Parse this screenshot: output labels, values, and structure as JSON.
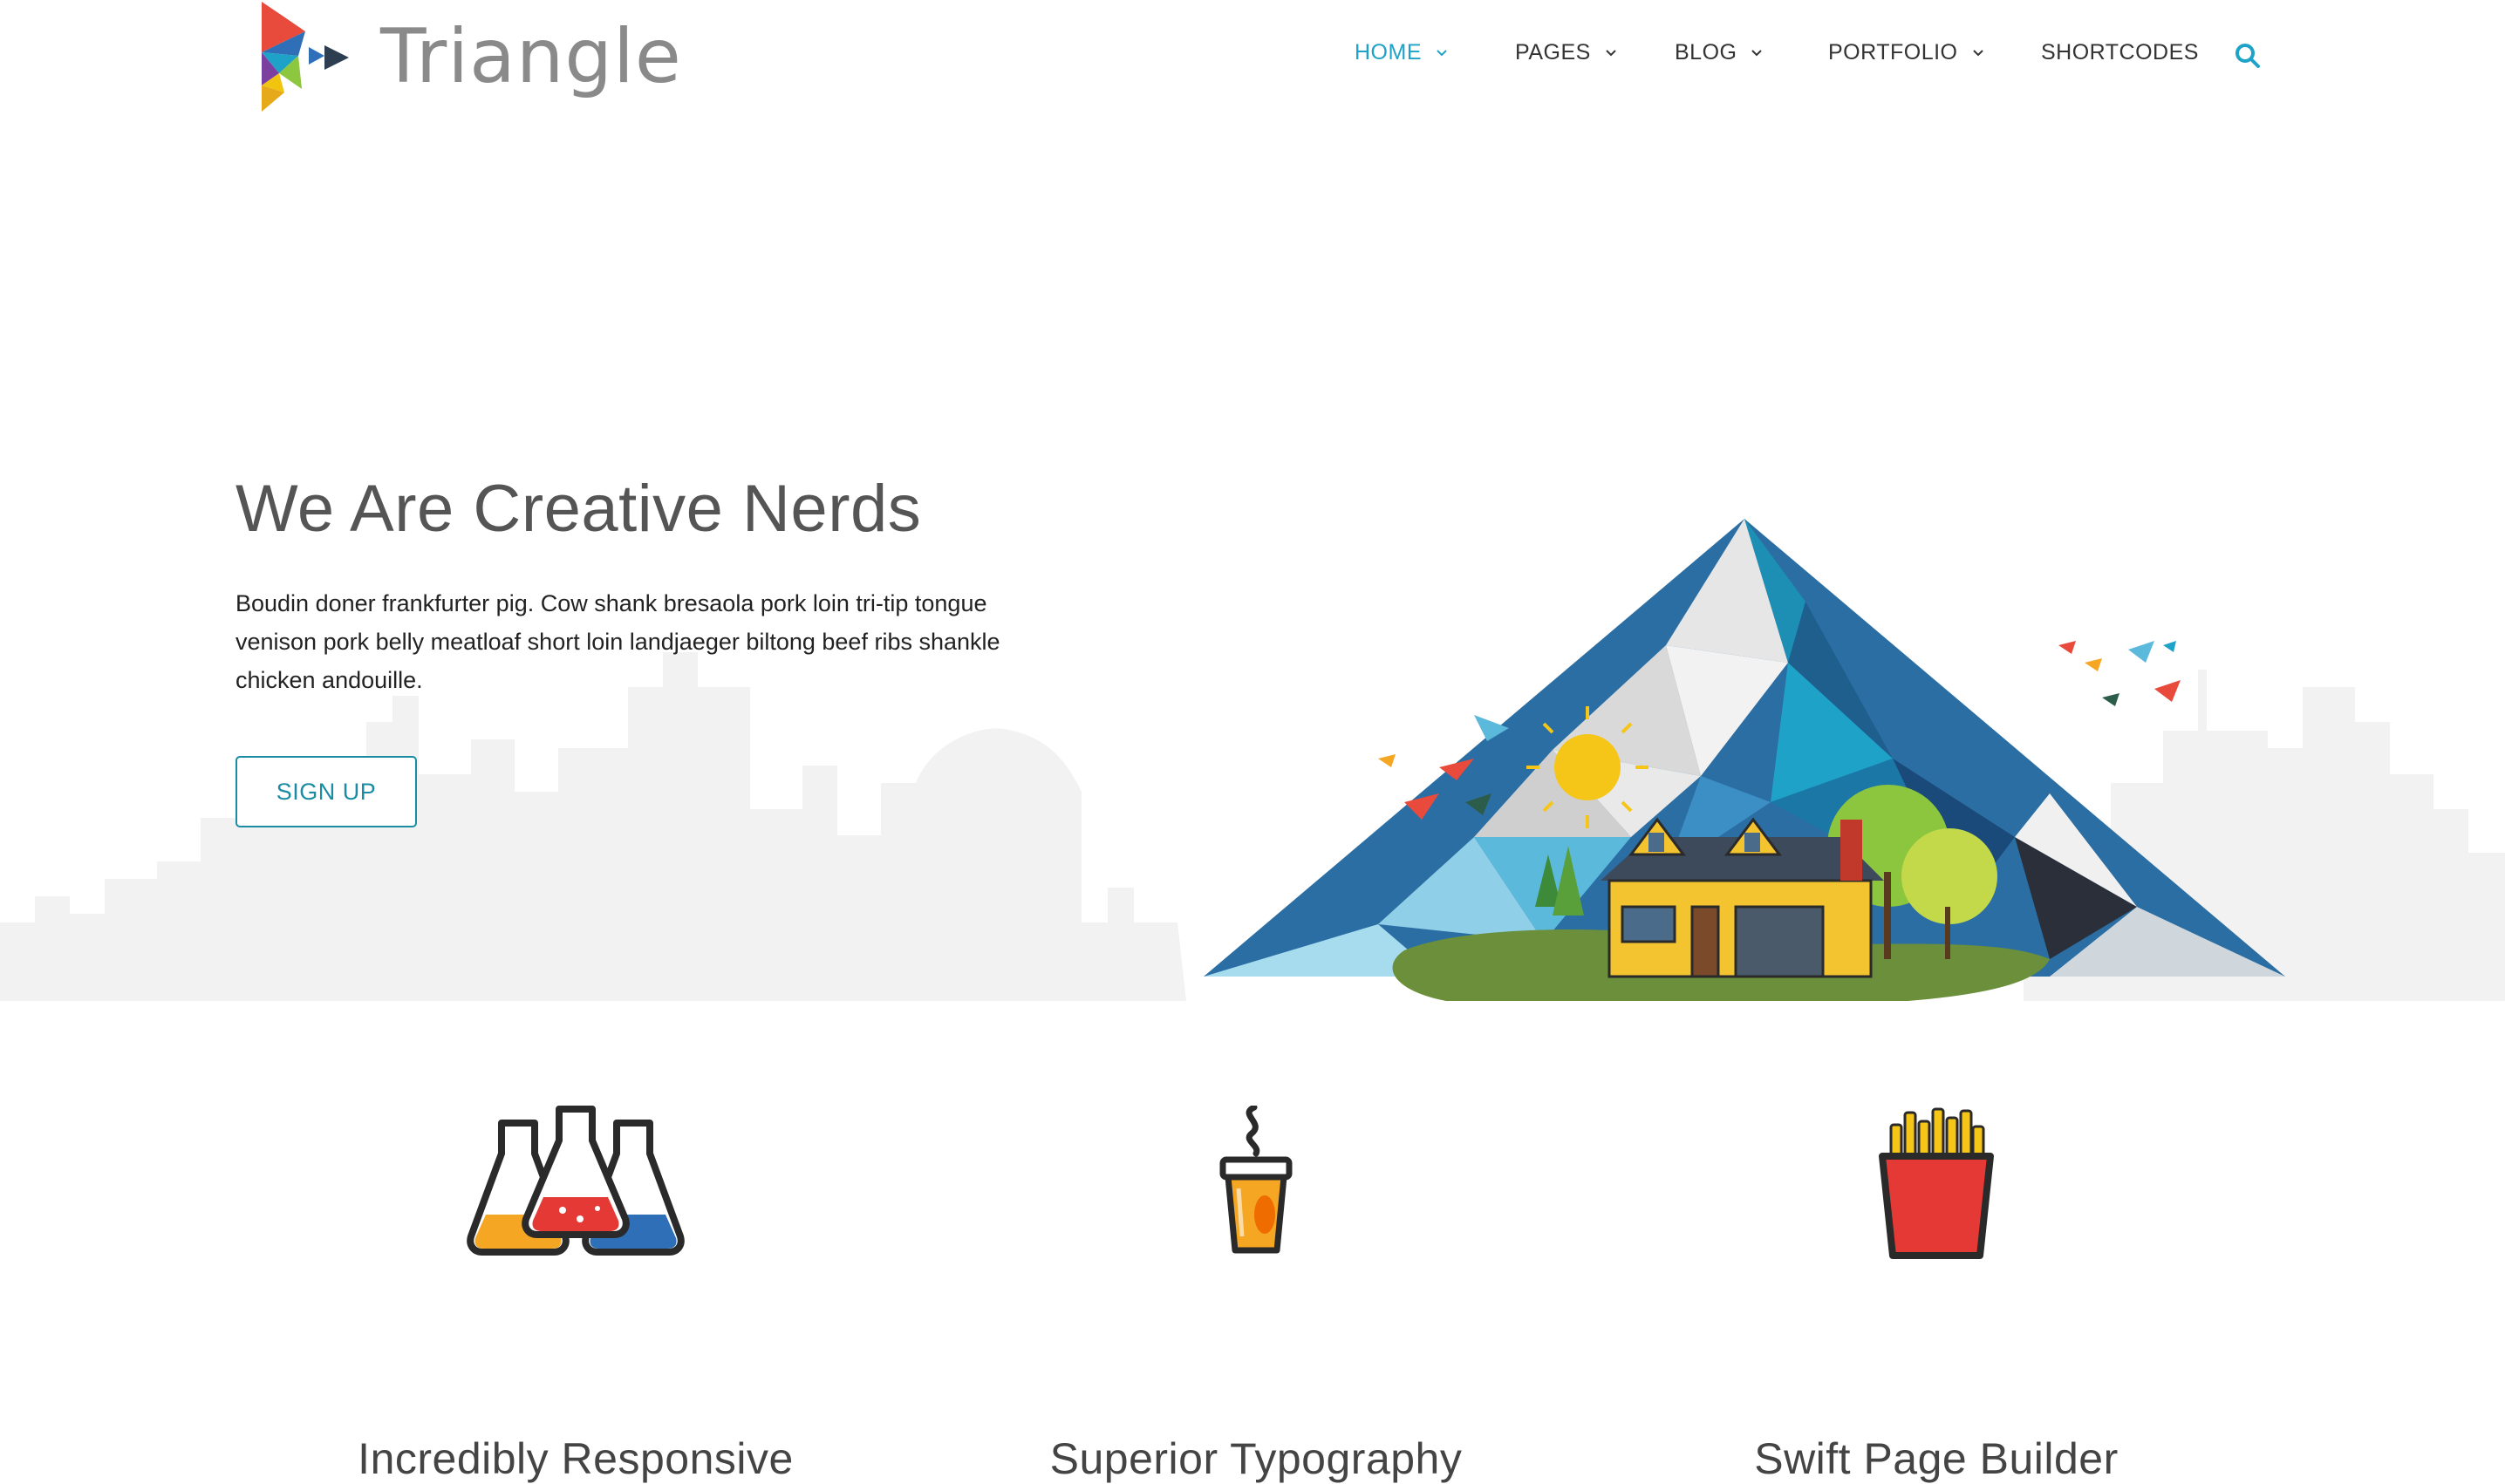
{
  "brand": {
    "name": "Triangle"
  },
  "nav": {
    "items": [
      {
        "label": "HOME",
        "has_dropdown": true,
        "active": true
      },
      {
        "label": "PAGES",
        "has_dropdown": true,
        "active": false
      },
      {
        "label": "BLOG",
        "has_dropdown": true,
        "active": false
      },
      {
        "label": "PORTFOLIO",
        "has_dropdown": true,
        "active": false
      },
      {
        "label": "SHORTCODES",
        "has_dropdown": false,
        "active": false
      }
    ],
    "search_icon": "search-icon"
  },
  "hero": {
    "title": "We Are Creative Nerds",
    "text": "Boudin doner frankfurter pig. Cow shank bresaola pork loin tri-tip tongue venison pork belly meatloaf short loin landjaeger biltong beef ribs shankle chicken andouille.",
    "button_label": "SIGN UP"
  },
  "features": [
    {
      "title": "Incredibly Responsive",
      "icon": "flasks-icon"
    },
    {
      "title": "Superior Typography",
      "icon": "coffee-cup-icon"
    },
    {
      "title": "Swift Page Builder",
      "icon": "fries-icon"
    }
  ],
  "colors": {
    "accent": "#1fa2c8",
    "button_border": "#1a8ca3",
    "skyline": "#f2f2f2",
    "text": "#222222"
  }
}
